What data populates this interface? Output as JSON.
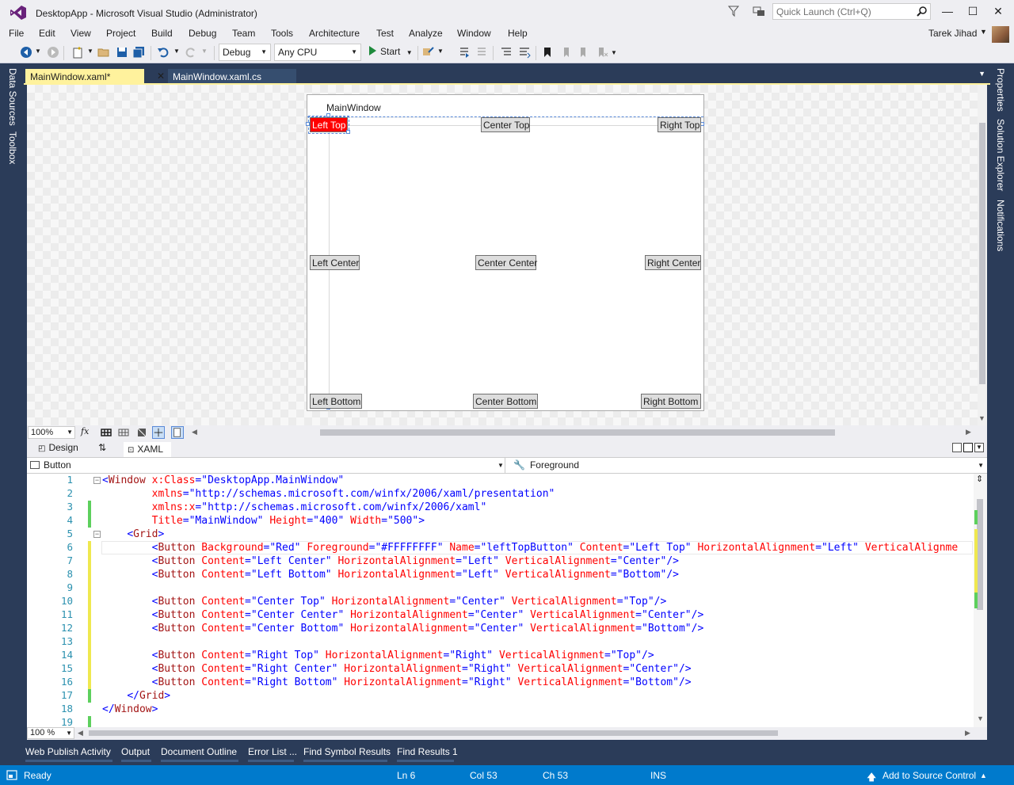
{
  "window": {
    "title": "DesktopApp - Microsoft Visual Studio  (Administrator)",
    "quick_launch_placeholder": "Quick Launch (Ctrl+Q)",
    "minimize": "—",
    "maximize": "☐",
    "close": "✕"
  },
  "menu": {
    "items": [
      "File",
      "Edit",
      "View",
      "Project",
      "Build",
      "Debug",
      "Team",
      "Tools",
      "Architecture",
      "Test",
      "Analyze",
      "Window",
      "Help"
    ],
    "user": "Tarek Jihad"
  },
  "toolbar": {
    "config": "Debug",
    "platform": "Any CPU",
    "start_label": "Start"
  },
  "side_tabs": {
    "left": [
      "Data Sources",
      "Toolbox"
    ],
    "right": [
      "Properties",
      "Solution Explorer",
      "Notifications"
    ]
  },
  "doc_tabs": {
    "active": "MainWindow.xaml*",
    "inactive": "MainWindow.xaml.cs"
  },
  "designer": {
    "window_title": "MainWindow",
    "buttons": {
      "left_top": "Left Top",
      "center_top": "Center Top",
      "right_top": "Right Top",
      "left_center": "Left Center",
      "center_center": "Center Center",
      "right_center": "Right Center",
      "left_bottom": "Left Bottom",
      "center_bottom": "Center Bottom",
      "right_bottom": "Right Bottom"
    },
    "zoom": "100%"
  },
  "split": {
    "design_tab": "Design",
    "xaml_tab": "XAML"
  },
  "element_bar": {
    "element": "Button",
    "property": "Foreground"
  },
  "editor": {
    "zoom": "100 %",
    "line_numbers": [
      "1",
      "2",
      "3",
      "4",
      "5",
      "6",
      "7",
      "8",
      "9",
      "10",
      "11",
      "12",
      "13",
      "14",
      "15",
      "16",
      "17",
      "18",
      "19"
    ]
  },
  "bottom_tabs": [
    "Web Publish Activity",
    "Output",
    "Document Outline",
    "Error List ...",
    "Find Symbol Results",
    "Find Results 1"
  ],
  "status": {
    "ready": "Ready",
    "ln": "Ln 6",
    "col": "Col 53",
    "ch": "Ch 53",
    "ins": "INS",
    "source_control": "Add to Source Control"
  },
  "colors": {
    "accent": "#007acc",
    "active_tab": "#fff29d",
    "chrome_dark": "#2b3c59",
    "selected_button": "#ff0000"
  }
}
